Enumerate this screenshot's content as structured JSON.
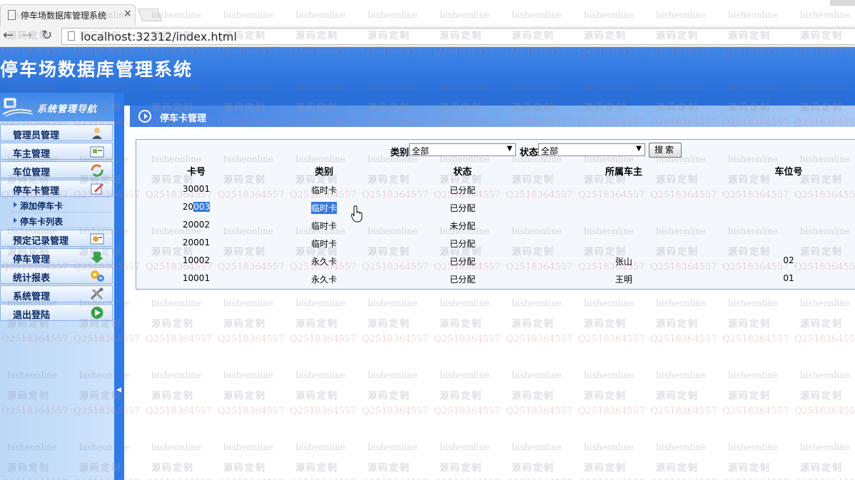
{
  "browser": {
    "tab_title": "停车场数据库管理系统",
    "tab_close": "×",
    "url": "localhost:32312/index.html",
    "back": "←",
    "forward": "→",
    "reload": "↻"
  },
  "app": {
    "title": "停车场数据库管理系统",
    "sidebar_title": "系统管理导航"
  },
  "menu": [
    {
      "label": "管理员管理",
      "icon": "admin-user-icon"
    },
    {
      "label": "车主管理",
      "icon": "owner-card-icon"
    },
    {
      "label": "车位管理",
      "icon": "parking-space-icon"
    },
    {
      "label": "停车卡管理",
      "icon": "parking-card-icon"
    },
    {
      "label": "预定记录管理",
      "icon": "reservation-icon"
    },
    {
      "label": "停车管理",
      "icon": "parking-arrow-icon"
    },
    {
      "label": "统计报表",
      "icon": "statistics-gear-icon"
    },
    {
      "label": "系统管理",
      "icon": "tools-icon"
    },
    {
      "label": "退出登陆",
      "icon": "exit-play-icon"
    }
  ],
  "submenu": [
    {
      "label": "添加停车卡"
    },
    {
      "label": "停车卡列表"
    }
  ],
  "panel": {
    "title": "停车卡管理"
  },
  "filters": {
    "category_label": "类别",
    "category_value": "全部",
    "status_label": "状态",
    "status_value": "全部",
    "search_button": "搜索",
    "select_arrow": "▼"
  },
  "table": {
    "columns": [
      "卡号",
      "类别",
      "状态",
      "所属车主",
      "车位号"
    ],
    "rows": [
      {
        "card_no": "30001",
        "category": "临时卡",
        "status": "已分配",
        "owner": "",
        "space": ""
      },
      {
        "card_no": "20003",
        "category": "临时卡",
        "status": "已分配",
        "owner": "",
        "space": ""
      },
      {
        "card_no": "20002",
        "category": "临时卡",
        "status": "未分配",
        "owner": "",
        "space": ""
      },
      {
        "card_no": "20001",
        "category": "临时卡",
        "status": "已分配",
        "owner": "",
        "space": ""
      },
      {
        "card_no": "10002",
        "category": "永久卡",
        "status": "已分配",
        "owner": "张山",
        "space": "02"
      },
      {
        "card_no": "10001",
        "category": "永久卡",
        "status": "已分配",
        "owner": "王明",
        "space": "01"
      }
    ],
    "selection_row_card_prefix": "20",
    "selection_row_card_selected": "003"
  },
  "watermark": {
    "line1": "bisheonline",
    "line2": "源码定制",
    "line3": "Q2518364557"
  },
  "colors": {
    "banner": "#2a6fd8",
    "sidebar": "#cfe3fb",
    "menu_text": "#0b2a66",
    "selection": "#3478e0"
  }
}
